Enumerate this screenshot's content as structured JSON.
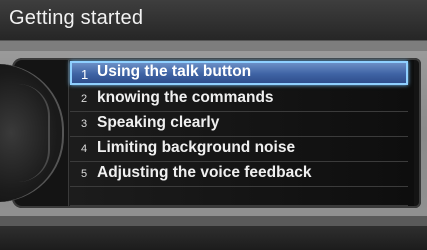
{
  "screen": {
    "title": "Getting started"
  },
  "menu": {
    "items": [
      {
        "number": "1",
        "label": "Using the talk button",
        "selected": true
      },
      {
        "number": "2",
        "label": "knowing the commands",
        "selected": false
      },
      {
        "number": "3",
        "label": "Speaking clearly",
        "selected": false
      },
      {
        "number": "4",
        "label": "Limiting background noise",
        "selected": false
      },
      {
        "number": "5",
        "label": "Adjusting the voice feedback",
        "selected": false
      }
    ]
  },
  "colors": {
    "selection_fill": "#3f63a4",
    "selection_border": "#8fd0ff",
    "background": "#202020"
  }
}
